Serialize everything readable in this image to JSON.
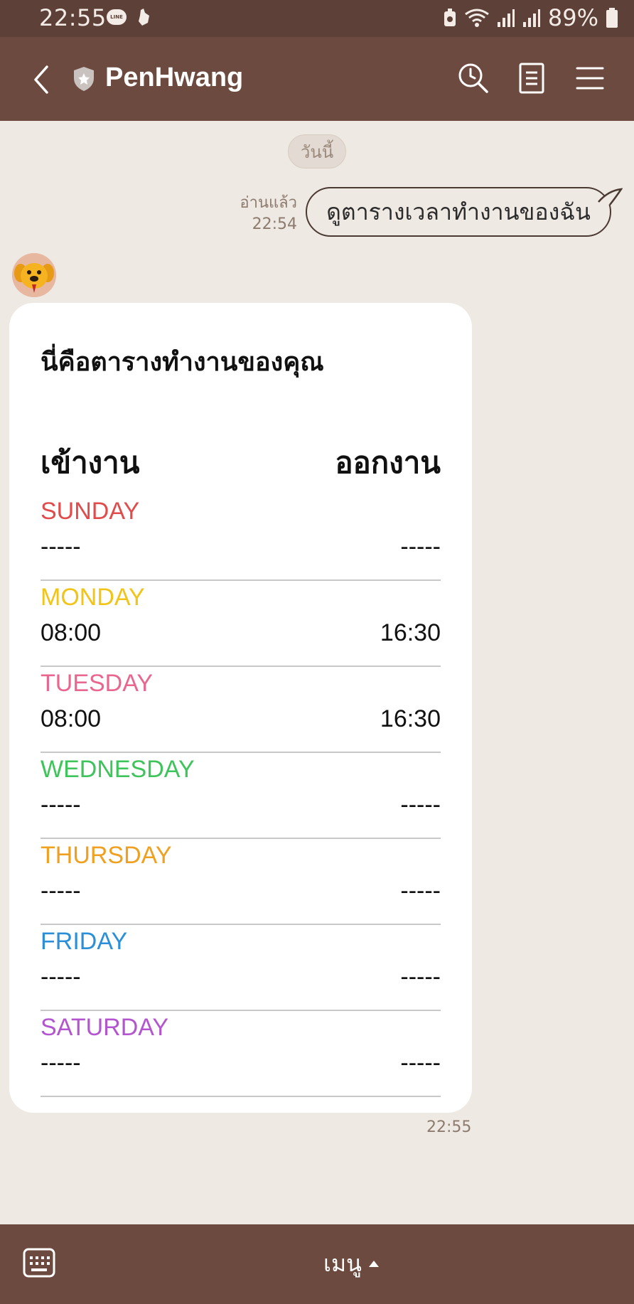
{
  "status_bar": {
    "time": "22:55",
    "line_badge": "LINE",
    "battery": "89%",
    "icons": [
      "line-app-icon",
      "hand-icon",
      "battery-saver-icon",
      "wifi-icon",
      "signal-icon",
      "signal-icon",
      "battery-icon"
    ]
  },
  "header": {
    "title": "PenHwang",
    "icons": [
      "back-chevron-icon",
      "official-shield-icon",
      "search-icon",
      "notes-icon",
      "menu-icon"
    ]
  },
  "chat": {
    "date_label": "วันนี้",
    "outgoing": {
      "read_label": "อ่านแล้ว",
      "time": "22:54",
      "text": "ดูตารางเวลาทำงานของฉัน"
    },
    "incoming": {
      "avatar": "dog-avatar",
      "card_title": "นี่คือตารางทำงานของคุณ",
      "col_in": "เข้างาน",
      "col_out": "ออกงาน",
      "days": [
        {
          "name": "SUNDAY",
          "in": "-----",
          "out": "-----",
          "color": "#e04b4b"
        },
        {
          "name": "MONDAY",
          "in": "08:00",
          "out": "16:30",
          "color": "#f0c419"
        },
        {
          "name": "TUESDAY",
          "in": "08:00",
          "out": "16:30",
          "color": "#e9668f"
        },
        {
          "name": "WEDNESDAY",
          "in": "-----",
          "out": "-----",
          "color": "#3ec45a"
        },
        {
          "name": "THURSDAY",
          "in": "-----",
          "out": "-----",
          "color": "#f0a020"
        },
        {
          "name": "FRIDAY",
          "in": "-----",
          "out": "-----",
          "color": "#2b8fd8"
        },
        {
          "name": "SATURDAY",
          "in": "-----",
          "out": "-----",
          "color": "#b455d0"
        }
      ],
      "time": "22:55"
    }
  },
  "bottom_bar": {
    "menu_label": "เมนู",
    "icons": [
      "keyboard-icon",
      "caret-up-icon"
    ]
  },
  "colors": {
    "header_bg": "#6d4a3f",
    "status_bg": "#5d4037",
    "chat_bg": "#efe9e3"
  }
}
